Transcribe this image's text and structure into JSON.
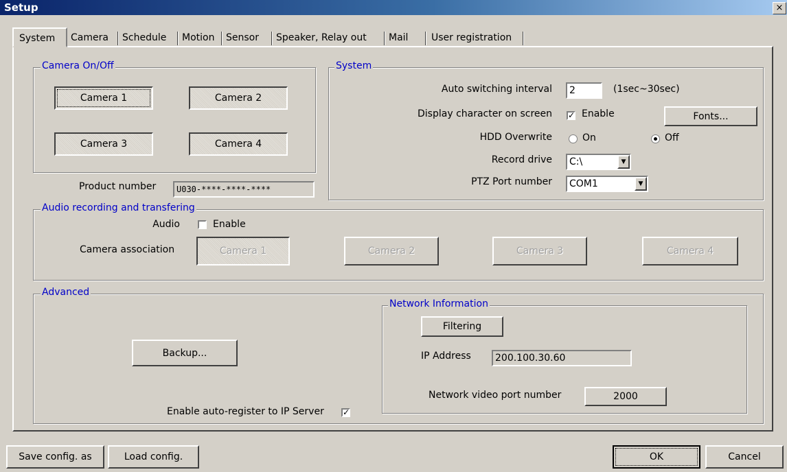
{
  "window": {
    "title": "Setup",
    "close": "×"
  },
  "tabs": [
    "System",
    "Camera",
    "Schedule",
    "Motion",
    "Sensor",
    "Speaker, Relay out",
    "Mail",
    "User registration"
  ],
  "camera_onoff": {
    "legend": "Camera On/Off",
    "buttons": [
      "Camera 1",
      "Camera 2",
      "Camera 3",
      "Camera 4"
    ]
  },
  "product": {
    "label": "Product number",
    "value": "U030-****-****-****"
  },
  "system": {
    "legend": "System",
    "auto_switch_label": "Auto switching interval",
    "auto_switch_value": "2",
    "auto_switch_range": "(1sec~30sec)",
    "display_label": "Display character on screen",
    "display_check": "Enable",
    "display_checked": true,
    "fonts_button": "Fonts...",
    "hdd_label": "HDD Overwrite",
    "hdd_on": "On",
    "hdd_off": "Off",
    "hdd_selected": "Off",
    "record_label": "Record drive",
    "record_value": "C:\\",
    "ptz_label": "PTZ Port number",
    "ptz_value": "COM1"
  },
  "audio": {
    "legend": "Audio recording and transfering",
    "audio_label": "Audio",
    "audio_check": "Enable",
    "audio_checked": false,
    "assoc_label": "Camera association",
    "buttons": [
      "Camera 1",
      "Camera 2",
      "Camera 3",
      "Camera 4"
    ]
  },
  "advanced": {
    "legend": "Advanced",
    "backup_button": "Backup...",
    "auto_register_label": "Enable auto-register to IP Server",
    "auto_register_checked": true
  },
  "network": {
    "legend": "Network Information",
    "filtering_button": "Filtering",
    "ip_label": "IP Address",
    "ip_value": "200.100.30.60",
    "port_label": "Network video port number",
    "port_value": "2000"
  },
  "footer": {
    "save": "Save config. as",
    "load": "Load config.",
    "ok": "OK",
    "cancel": "Cancel"
  },
  "glyphs": {
    "check": "✓",
    "arrow": "▼"
  }
}
